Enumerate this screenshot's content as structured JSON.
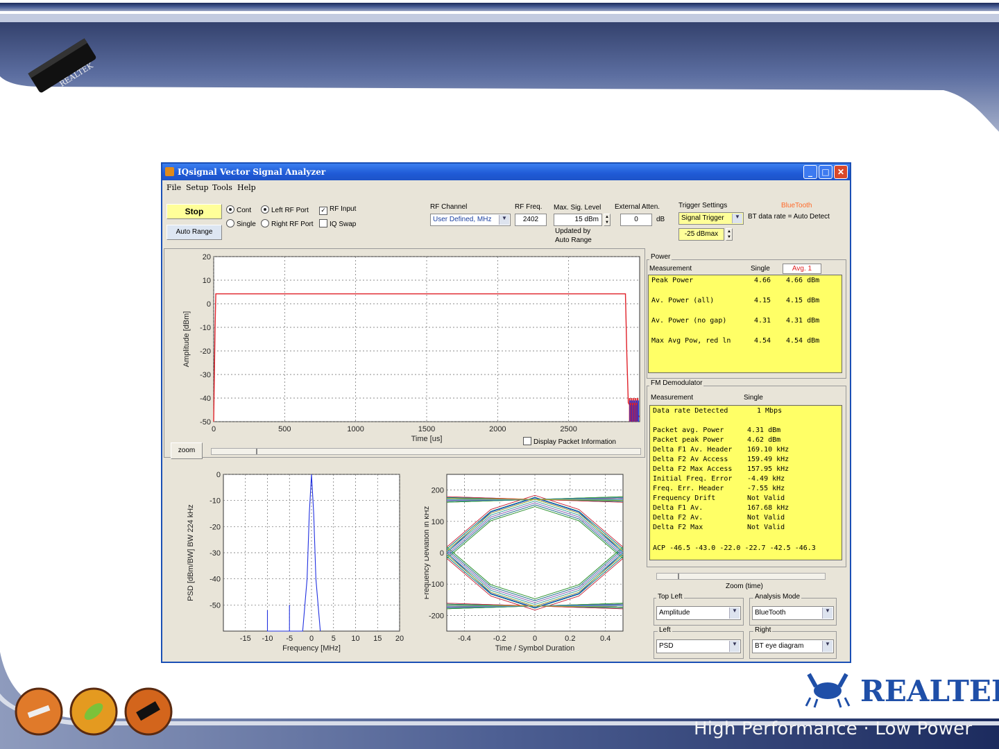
{
  "slide": {
    "brand": "REALTEK",
    "tagline": "High Performance · Low Power",
    "chip_label": "REALTEK",
    "colors": {
      "brand_blue": "#1f4fa8",
      "top_band": "#2a3d7a"
    }
  },
  "window": {
    "title": "IQsignal Vector Signal Analyzer",
    "menu": [
      "File",
      "Setup",
      "Tools",
      "Help"
    ],
    "icons": [
      "app-icon",
      "minimize-icon",
      "maximize-icon",
      "close-icon"
    ]
  },
  "controls": {
    "stop_label": "Stop",
    "auto_range_label": "Auto Range",
    "cont_label": "Cont",
    "single_label": "Single",
    "left_rf_label": "Left RF Port",
    "right_rf_label": "Right RF Port",
    "rf_input_label": "RF Input",
    "iq_swap_label": "IQ Swap",
    "rf_channel_label": "RF Channel",
    "rf_channel_value": "User Defined, MHz",
    "rf_freq_label": "RF Freq.",
    "rf_freq_value": "2402",
    "max_sig_label": "Max. Sig. Level",
    "max_sig_value": "15  dBm",
    "updated_by_label": "Updated by",
    "updated_by_value": "Auto Range",
    "ext_atten_label": "External Atten.",
    "ext_atten_value": "0",
    "ext_atten_unit": "dB",
    "trigger_label": "Trigger Settings",
    "trigger_value": "Signal Trigger",
    "trigger_level": "-25  dBmax",
    "bluetooth_label": "BlueTooth",
    "bt_rate_label": "BT data rate = Auto Detect",
    "zoom_label": "zoom",
    "display_packet_label": "Display Packet Information"
  },
  "power_panel": {
    "title": "Power",
    "measurement_label": "Measurement",
    "single_label": "Single",
    "avg_label": "Avg.  1",
    "rows": [
      {
        "name": "Peak Power",
        "single": "4.66",
        "avg": "4.66 dBm"
      },
      {
        "name": "Av. Power (all)",
        "single": "4.15",
        "avg": "4.15 dBm"
      },
      {
        "name": "Av. Power (no gap)",
        "single": "4.31",
        "avg": "4.31 dBm"
      },
      {
        "name": "Max Avg Pow, red ln",
        "single": "4.54",
        "avg": "4.54 dBm"
      }
    ]
  },
  "fm_panel": {
    "title": "FM Demodulator",
    "measurement_label": "Measurement",
    "single_label": "Single",
    "data_rate": {
      "name": "Data rate Detected",
      "value": "1 Mbps"
    },
    "rows": [
      {
        "name": "Packet avg. Power",
        "value": "4.31 dBm"
      },
      {
        "name": "Packet peak Power",
        "value": "4.62 dBm"
      },
      {
        "name": "Delta F1 Av. Header",
        "value": "169.10 kHz"
      },
      {
        "name": "Delta F2 Av Access",
        "value": "159.49 kHz"
      },
      {
        "name": "Delta F2 Max Access",
        "value": "157.95 kHz"
      },
      {
        "name": "Initial Freq. Error",
        "value": "-4.49 kHz"
      },
      {
        "name": "Freq. Err. Header",
        "value": "-7.55 kHz"
      },
      {
        "name": "Frequency Drift",
        "value": "Not Valid"
      },
      {
        "name": "Delta F1 Av.",
        "value": "167.68 kHz"
      },
      {
        "name": "Delta F2 Av.",
        "value": "Not Valid"
      },
      {
        "name": "Delta F2 Max",
        "value": "Not Valid"
      }
    ],
    "acp": "ACP -46.5 -43.0 -22.0 -22.7 -42.5 -46.3"
  },
  "lower_right": {
    "zoom_time_label": "Zoom (time)",
    "top_left_label": "Top Left",
    "top_left_value": "Amplitude",
    "analysis_label": "Analysis Mode",
    "analysis_value": "BlueTooth",
    "left_label": "Left",
    "left_value": "PSD",
    "right_label": "Right",
    "right_value": "BT eye diagram"
  },
  "chart_data": [
    {
      "type": "line",
      "xlabel": "Time [us]",
      "ylabel": "Amplitude [dBm]",
      "xlim": [
        0,
        3000
      ],
      "ylim": [
        -50,
        20
      ],
      "xticks": [
        0,
        500,
        1000,
        1500,
        2000,
        2500
      ],
      "yticks": [
        20,
        10,
        0,
        -10,
        -20,
        -30,
        -40,
        -50
      ],
      "grid": true,
      "series": [
        {
          "x": [
            0,
            10,
            15,
            2900,
            2910,
            2920,
            2950,
            3000
          ],
          "y": [
            -50,
            -10,
            4.2,
            4.2,
            -22,
            -42,
            -45,
            -48
          ]
        }
      ]
    },
    {
      "type": "line",
      "xlabel": "Frequency [MHz]",
      "ylabel": "PSD  [dBm/BW]  BW 224 kHz",
      "xlim": [
        -20,
        20
      ],
      "ylim": [
        -60,
        0
      ],
      "xticks": [
        -15,
        -10,
        -5,
        0,
        5,
        10,
        15,
        20
      ],
      "yticks": [
        0,
        -10,
        -20,
        -30,
        -40,
        -50
      ],
      "grid": true,
      "series": [
        {
          "x": [
            -10,
            -10,
            -10,
            -5,
            -5,
            -5,
            -2,
            -1,
            -0.5,
            0,
            0.5,
            1,
            2
          ],
          "y": [
            -60,
            -52,
            -60,
            -60,
            -50,
            -60,
            -60,
            -40,
            -15,
            0,
            -15,
            -40,
            -60
          ]
        }
      ]
    },
    {
      "type": "line",
      "xlabel": "Time / Symbol Duration",
      "ylabel": "Frequency Deviation in kHz",
      "xlim": [
        -0.5,
        0.5
      ],
      "ylim": [
        -250,
        250
      ],
      "xticks": [
        -0.4,
        -0.2,
        0,
        0.2,
        0.4
      ],
      "yticks": [
        200,
        100,
        0,
        -100,
        -200
      ],
      "grid": true,
      "series": [
        {
          "x": [
            -0.5,
            -0.25,
            0,
            0.25,
            0.5
          ],
          "y": [
            170,
            170,
            170,
            170,
            170
          ]
        },
        {
          "x": [
            -0.5,
            -0.25,
            0,
            0.25,
            0.5
          ],
          "y": [
            -170,
            -170,
            -170,
            -170,
            -170
          ]
        },
        {
          "x": [
            -0.5,
            -0.25,
            0,
            0.25,
            0.5
          ],
          "y": [
            0,
            130,
            175,
            130,
            0
          ]
        },
        {
          "x": [
            -0.5,
            -0.25,
            0,
            0.25,
            0.5
          ],
          "y": [
            0,
            -130,
            -175,
            -130,
            0
          ]
        }
      ]
    }
  ]
}
